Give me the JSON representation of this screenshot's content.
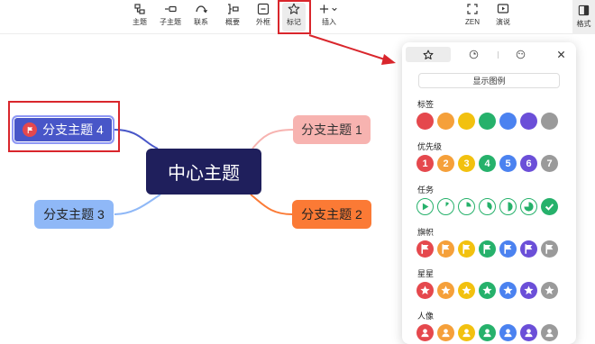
{
  "toolbar": {
    "topic": "主题",
    "subtopic": "子主题",
    "relation": "联系",
    "summary": "概要",
    "boundary": "外框",
    "marker": "标记",
    "insert": "插入",
    "zen": "ZEN",
    "present": "演说",
    "format": "格式"
  },
  "mindmap": {
    "center": "中心主题",
    "branch1": "分支主题 1",
    "branch2": "分支主题 2",
    "branch3": "分支主题 3",
    "branch4": "分支主题 4"
  },
  "panel": {
    "legend_button": "显示图例",
    "sections": {
      "labels": "标签",
      "priority": "优先级",
      "task": "任务",
      "flag": "旗帜",
      "star": "星星",
      "person": "人像"
    },
    "priority_numbers": [
      "1",
      "2",
      "3",
      "4",
      "5",
      "6",
      "7"
    ]
  },
  "colors": {
    "red": "#e5484d",
    "orange": "#f5a03a",
    "yellow": "#f2c10f",
    "green": "#26b16b",
    "blue": "#4b82f0",
    "purple": "#6b4fd8",
    "gray": "#9a9a9a",
    "highlight": "#d9262c",
    "center_node": "#1f1f5c"
  }
}
